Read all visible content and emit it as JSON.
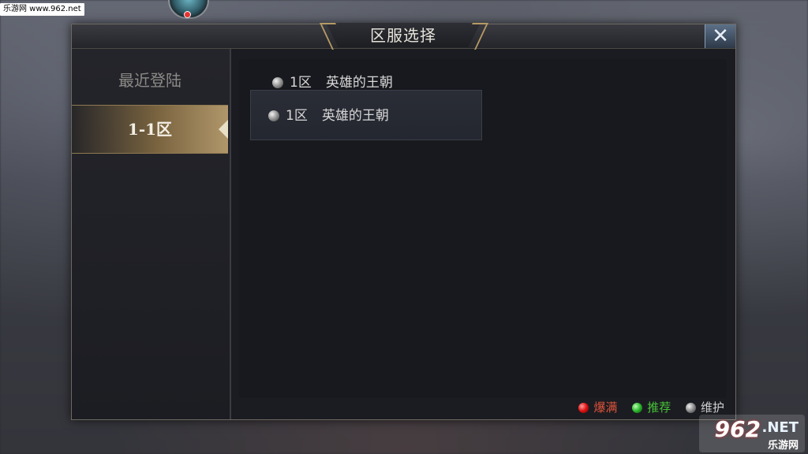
{
  "watermark_top": "乐游网 www.962.net",
  "dialog": {
    "title": "区服选择",
    "close_icon": "close-x-icon"
  },
  "sidebar": {
    "items": [
      {
        "label": "最近登陆",
        "active": false
      },
      {
        "label": "1-1区",
        "active": true
      }
    ]
  },
  "servers": {
    "recent": {
      "zone": "1区",
      "name": "英雄的王朝",
      "status": "maintenance"
    },
    "list": [
      {
        "zone": "1区",
        "name": "英雄的王朝",
        "status": "maintenance"
      }
    ]
  },
  "legend": {
    "full": "爆满",
    "recommended": "推荐",
    "maintenance": "维护",
    "colors": {
      "full": "#d11111",
      "recommended": "#2bb52b",
      "maintenance": "#8a8a8a"
    }
  },
  "watermark_br": {
    "num": "962",
    "net": ".NET",
    "cn": "乐游网"
  }
}
